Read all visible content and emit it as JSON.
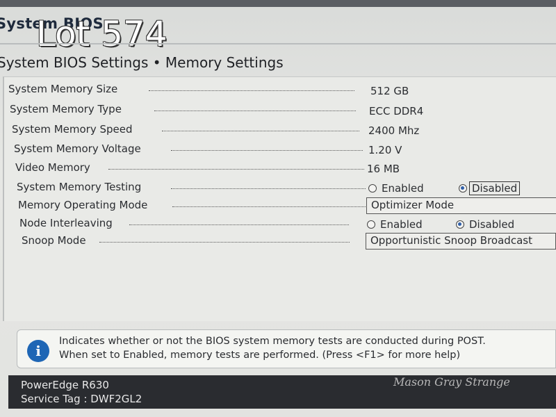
{
  "app": {
    "title": "System BIOS"
  },
  "overlay": {
    "lot": "Lot 574"
  },
  "breadcrumb": "System BIOS Settings • Memory Settings",
  "settings": {
    "memory_size": {
      "label": "System Memory Size",
      "value": "512 GB"
    },
    "memory_type": {
      "label": "System Memory Type",
      "value": "ECC DDR4"
    },
    "memory_speed": {
      "label": "System Memory Speed",
      "value": "2400 Mhz"
    },
    "memory_voltage": {
      "label": "System Memory Voltage",
      "value": "1.20 V"
    },
    "video_memory": {
      "label": "Video Memory",
      "value": "16 MB"
    },
    "memory_testing": {
      "label": "System Memory Testing",
      "options": [
        "Enabled",
        "Disabled"
      ],
      "selected": "Disabled"
    },
    "operating_mode": {
      "label": "Memory Operating Mode",
      "value": "Optimizer Mode"
    },
    "node_interleaving": {
      "label": "Node Interleaving",
      "options": [
        "Enabled",
        "Disabled"
      ],
      "selected": "Disabled"
    },
    "snoop_mode": {
      "label": "Snoop Mode",
      "value": "Opportunistic Snoop Broadcast"
    }
  },
  "help": {
    "icon": "info-icon",
    "line1": "Indicates whether or not the BIOS system memory tests are conducted during POST.",
    "line2": "When set to Enabled, memory tests are performed. (Press <F1> for more help)"
  },
  "footer": {
    "model": "PowerEdge R630",
    "service_tag": "Service Tag : DWF2GL2"
  },
  "watermark": "Mason Gray Strange",
  "colors": {
    "accent": "#1e66b5",
    "footer_bg": "#2a2c30",
    "radio_selected": "#2f5fa8"
  }
}
